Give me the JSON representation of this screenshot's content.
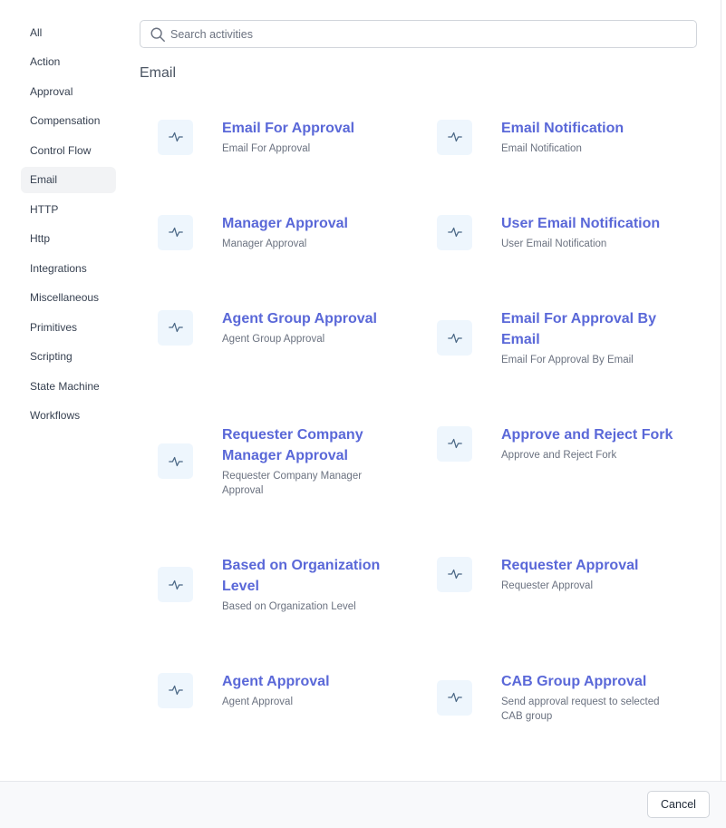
{
  "sidebar": {
    "items": [
      {
        "label": "All"
      },
      {
        "label": "Action"
      },
      {
        "label": "Approval"
      },
      {
        "label": "Compensation"
      },
      {
        "label": "Control Flow"
      },
      {
        "label": "Email",
        "active": true
      },
      {
        "label": "HTTP"
      },
      {
        "label": "Http"
      },
      {
        "label": "Integrations"
      },
      {
        "label": "Miscellaneous"
      },
      {
        "label": "Primitives"
      },
      {
        "label": "Scripting"
      },
      {
        "label": "State Machine"
      },
      {
        "label": "Workflows"
      }
    ]
  },
  "search": {
    "placeholder": "Search activities",
    "value": ""
  },
  "section": {
    "title": "Email"
  },
  "activities": [
    {
      "title": "Email For Approval",
      "desc": "Email For Approval",
      "icon": "activity-icon"
    },
    {
      "title": "Email Notification",
      "desc": "Email Notification",
      "icon": "activity-icon"
    },
    {
      "title": "Manager Approval",
      "desc": "Manager Approval",
      "icon": "activity-icon"
    },
    {
      "title": "User Email Notification",
      "desc": "User Email Notification",
      "icon": "activity-icon"
    },
    {
      "title": "Agent Group Approval",
      "desc": "Agent Group Approval",
      "icon": "activity-icon"
    },
    {
      "title": "Email For Approval By Email",
      "desc": "Email For Approval By Email",
      "icon": "activity-icon"
    },
    {
      "title": "Requester Company Manager Approval",
      "desc": "Requester Company Manager Approval",
      "icon": "activity-icon"
    },
    {
      "title": "Approve and Reject Fork",
      "desc": "Approve and Reject Fork",
      "icon": "activity-icon"
    },
    {
      "title": "Based on Organization Level",
      "desc": "Based on Organization Level",
      "icon": "activity-icon"
    },
    {
      "title": "Requester Approval",
      "desc": "Requester Approval",
      "icon": "activity-icon"
    },
    {
      "title": "Agent Approval",
      "desc": "Agent Approval",
      "icon": "activity-icon"
    },
    {
      "title": "CAB Group Approval",
      "desc": "Send approval request to selected CAB group",
      "icon": "activity-icon"
    }
  ],
  "footer": {
    "cancel_label": "Cancel"
  },
  "colors": {
    "accent": "#5a68d8",
    "icon_bg": "#eef6fd",
    "active_bg": "#f2f3f5"
  }
}
